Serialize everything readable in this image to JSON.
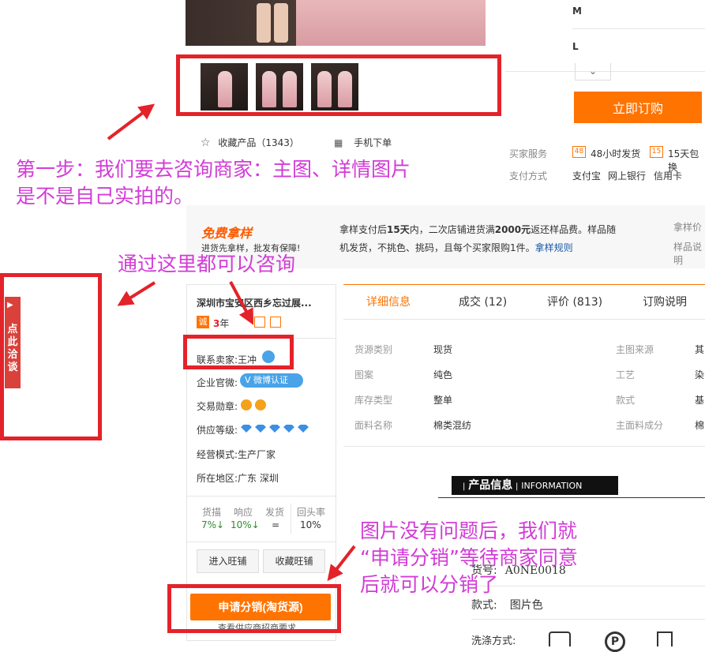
{
  "sizes": [
    "M",
    "L"
  ],
  "order_button": "立即订购",
  "favorite": {
    "label": "收藏产品（1343）"
  },
  "mobile_order": "手机下单",
  "buyer_service": {
    "label": "买家服务",
    "items": [
      "48小时发货",
      "15天包换"
    ]
  },
  "payment": {
    "label": "支付方式",
    "items": [
      "支付宝",
      "网上银行",
      "信用卡"
    ]
  },
  "free_sample": {
    "badge": "免费拿样",
    "subtitle": "进货先拿样，批发有保障!",
    "text_line1_a": "拿样支付后",
    "text_line1_b": "15天",
    "text_line1_c": "内，二次店铺进货满",
    "text_line1_d": "2000元",
    "text_line1_e": "返还样品费。样品随",
    "text_line2": "机发货，不挑色、挑码，且每个买家限购1件。",
    "rules_link": "拿样规则",
    "right_1": "拿样价",
    "right_2": "样品说明"
  },
  "seller": {
    "company": "深圳市宝安区西乡忘过展...",
    "cheng_badge": "诚",
    "years": "3",
    "years_unit": "年",
    "contact_label": "联系卖家:",
    "contact_name": "王冲",
    "weibo_label": "企业官微:",
    "weibo_badge": "微博认证",
    "medal_label": "交易勋章:",
    "level_label": "供应等级:",
    "diamonds": 5,
    "mode_label": "经营模式:",
    "mode_value": "生产厂家",
    "region_label": "所在地区:",
    "region_value": "广东 深圳",
    "stats": [
      {
        "name": "货描",
        "value": "7%↓"
      },
      {
        "name": "响应",
        "value": "10%↓"
      },
      {
        "name": "发货",
        "value": "="
      },
      {
        "name": "回头率",
        "value": "10%"
      }
    ],
    "enter_shop": "进入旺铺",
    "fav_shop": "收藏旺铺",
    "apply_button": "申请分销(淘货源)",
    "apply_sub": "查看供应商招商要求"
  },
  "side_chat": "点此洽谈",
  "tabs": [
    {
      "label": "详细信息"
    },
    {
      "label": "成交 (12)"
    },
    {
      "label": "评价 (813)"
    },
    {
      "label": "订购说明"
    }
  ],
  "attributes": [
    {
      "k": "货源类别",
      "v": "现货",
      "k2": "主图来源",
      "v2": "其"
    },
    {
      "k": "图案",
      "v": "纯色",
      "k2": "工艺",
      "v2": "染"
    },
    {
      "k": "库存类型",
      "v": "整单",
      "k2": "款式",
      "v2": "基"
    },
    {
      "k": "面料名称",
      "v": "棉类混纺",
      "k2": "主面料成分",
      "v2": "棉"
    }
  ],
  "product_info": {
    "cn": "产品信息",
    "en": "INFORMATION"
  },
  "detail": {
    "code_label": "货号:",
    "code_value": "A0NE0018",
    "style_label": "款式:",
    "style_value": "图片色",
    "wash_label": "洗涤方式:"
  },
  "annotations": {
    "step1_line1": "第一步：我们要去咨询商家：主图、详情图片",
    "step1_line2": "是不是自己实拍的。",
    "consult": "通过这里都可以咨询",
    "apply_line1": "图片没有问题后，我们就",
    "apply_line2": "“申请分销”等待商家同意",
    "apply_line3": "后就可以分销了"
  },
  "colors": {
    "annotation": "#d23cd6",
    "highlight": "#e4222a",
    "accent": "#ff7300"
  }
}
